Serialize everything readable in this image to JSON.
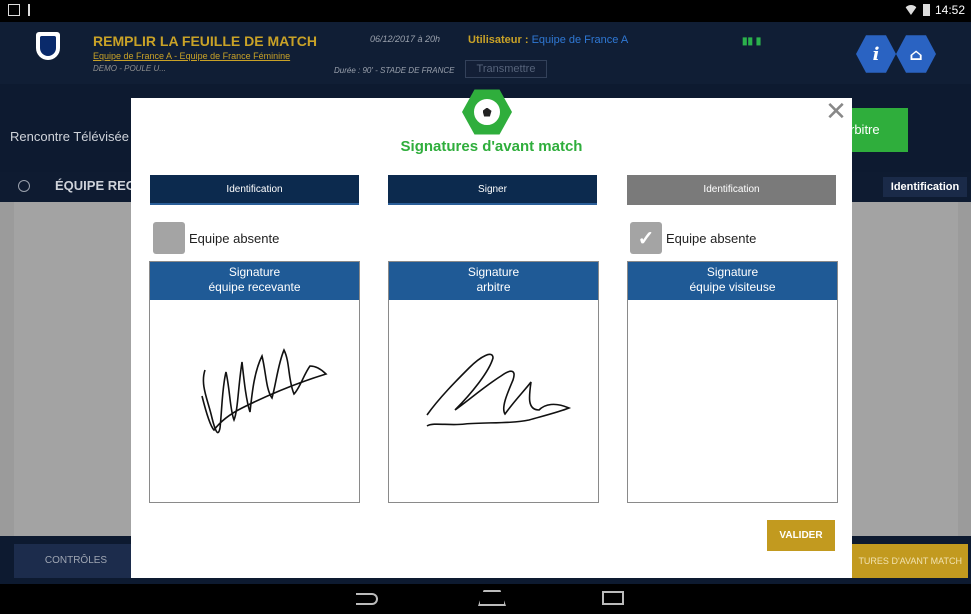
{
  "statusbar": {
    "time": "14:52"
  },
  "header": {
    "title": "REMPLIR LA FEUILLE DE MATCH",
    "match_link": "Equipe de France A",
    "match_rest": " - Equipe de France Féminine",
    "competition": "DEMO - POULE U...",
    "date": "06/12/2017 à 20h",
    "duration": "Durée : 90' - STADE DE FRANCE",
    "user_label": "Utilisateur :",
    "user_value": "Equipe de France A",
    "transmit_label": "Transmettre",
    "info_icon": "i",
    "home_icon": "⌂"
  },
  "background": {
    "rencontre": "Rencontre Télévisée",
    "arbitre": "rbitre",
    "equipe": "ÉQUIPE REC",
    "identification": "Identification",
    "controles": "CONTRÔLES",
    "signatures": "TURES D'AVANT MATCH"
  },
  "modal": {
    "title": "Signatures d'avant match",
    "close": "✕",
    "columns": [
      {
        "header": "Identification",
        "header_style": "dark",
        "absent_label": "Equipe absente",
        "absent_checked": false,
        "sig_line1": "Signature",
        "sig_line2": "équipe recevante"
      },
      {
        "header": "Signer",
        "header_style": "dark",
        "sig_line1": "Signature",
        "sig_line2": "arbitre"
      },
      {
        "header": "Identification",
        "header_style": "grey",
        "absent_label": "Equipe absente",
        "absent_checked": true,
        "sig_line1": "Signature",
        "sig_line2": "équipe visiteuse"
      }
    ],
    "valider": "VALIDER",
    "check_mark": "✓"
  },
  "colors": {
    "navy": "#101e35",
    "gold": "#c29a1f",
    "green": "#2fae3c",
    "blue": "#1f5a96"
  }
}
